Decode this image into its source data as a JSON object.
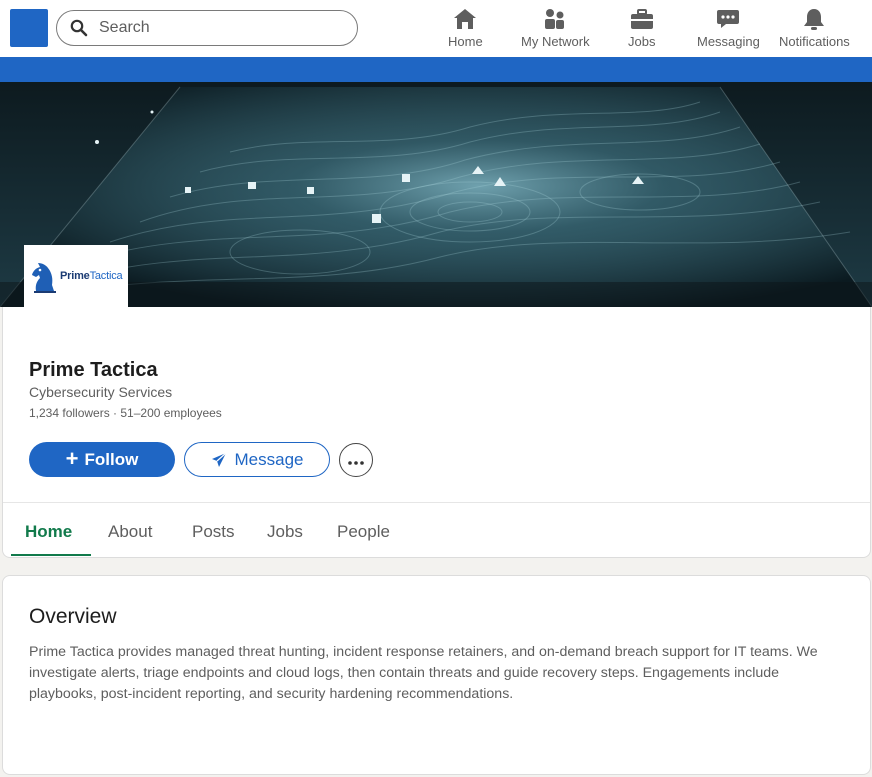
{
  "nav": {
    "search_placeholder": "Search",
    "items": [
      {
        "label": "Home",
        "icon": "home-icon"
      },
      {
        "label": "My Network",
        "icon": "network-icon"
      },
      {
        "label": "Jobs",
        "icon": "briefcase-icon"
      },
      {
        "label": "Messaging",
        "icon": "chat-icon"
      },
      {
        "label": "Notifications",
        "icon": "bell-icon"
      }
    ]
  },
  "company": {
    "logo_text_1": "Prime",
    "logo_text_2": "Tactica",
    "name": "Prime Tactica",
    "industry": "Cybersecurity Services",
    "stats": "1,234 followers · 51–200 employees"
  },
  "actions": {
    "follow_label": "Follow",
    "message_label": "Message"
  },
  "tabs": [
    {
      "label": "Home",
      "active": true
    },
    {
      "label": "About",
      "active": false
    },
    {
      "label": "Posts",
      "active": false
    },
    {
      "label": "Jobs",
      "active": false
    },
    {
      "label": "People",
      "active": false
    }
  ],
  "overview": {
    "title": "Overview",
    "text": "Prime Tactica provides managed threat hunting, incident response retainers, and on-demand breach support for IT teams. We investigate alerts, triage endpoints and cloud logs, then contain threats and guide recovery steps. Engagements include playbooks, post-incident reporting, and security hardening recommendations."
  },
  "colors": {
    "brand_blue": "#1f66c4",
    "active_tab_green": "#117a4b",
    "page_bg": "#f3f2ef"
  }
}
